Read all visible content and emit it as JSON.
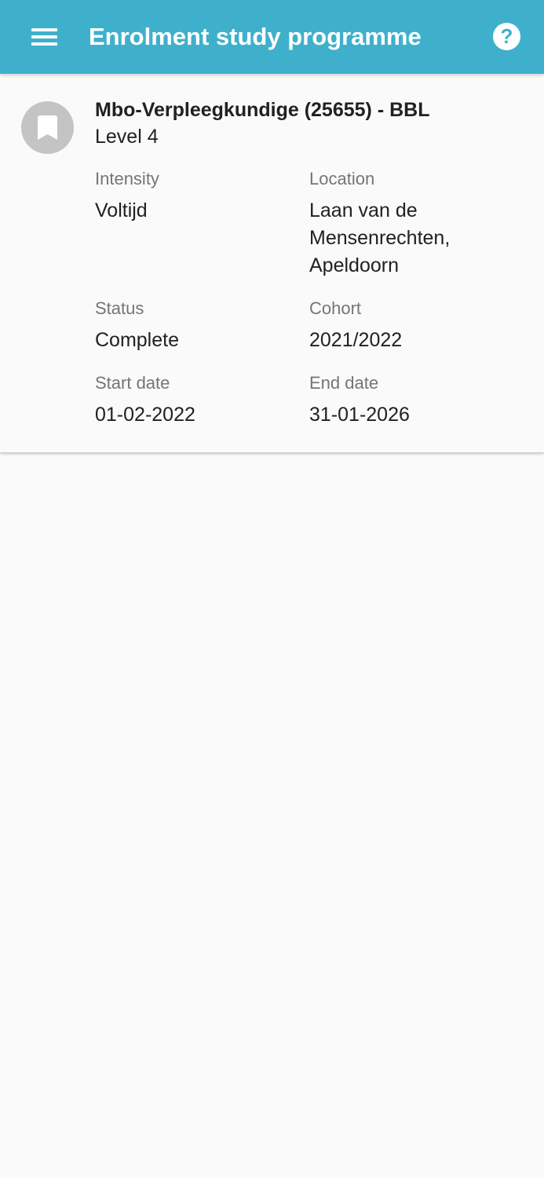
{
  "app_bar": {
    "title": "Enrolment study programme",
    "menu_icon": "hamburger-menu-icon",
    "help_icon": "help-circle-icon",
    "help_glyph": "?",
    "color": "#3fb0cb"
  },
  "enrolment": {
    "icon": "bookmark-icon",
    "title": "Mbo-Verpleegkundige (25655) - BBL",
    "level": "Level 4",
    "intensity": {
      "label": "Intensity",
      "value": "Voltijd"
    },
    "location": {
      "label": "Location",
      "value": "Laan van de Mensenrechten, Apeldoorn"
    },
    "status": {
      "label": "Status",
      "value": "Complete"
    },
    "cohort": {
      "label": "Cohort",
      "value": "2021/2022"
    },
    "start_date": {
      "label": "Start date",
      "value": "01-02-2022"
    },
    "end_date": {
      "label": "End date",
      "value": "31-01-2026"
    }
  }
}
